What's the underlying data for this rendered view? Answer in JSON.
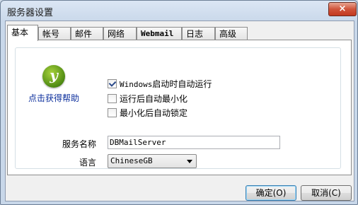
{
  "window": {
    "title": "服务器设置",
    "close_label": "×"
  },
  "tabs": [
    {
      "label": "基本"
    },
    {
      "label": "帐号"
    },
    {
      "label": "邮件"
    },
    {
      "label": "网络"
    },
    {
      "label": "Webmail"
    },
    {
      "label": "日志"
    },
    {
      "label": "高级"
    }
  ],
  "basic": {
    "help_link": "点击获得帮助",
    "checkboxes": [
      {
        "label_prefix": "Windows",
        "label": "启动时自动运行",
        "checked": true
      },
      {
        "label": "运行后自动最小化",
        "checked": false
      },
      {
        "label": "最小化后自动锁定",
        "checked": false
      }
    ],
    "service_name_label": "服务名称",
    "service_name_value": "DBMailServer",
    "language_label": "语言",
    "language_value": "ChineseGB"
  },
  "buttons": {
    "ok": "确定(O)",
    "cancel": "取消(C)"
  }
}
